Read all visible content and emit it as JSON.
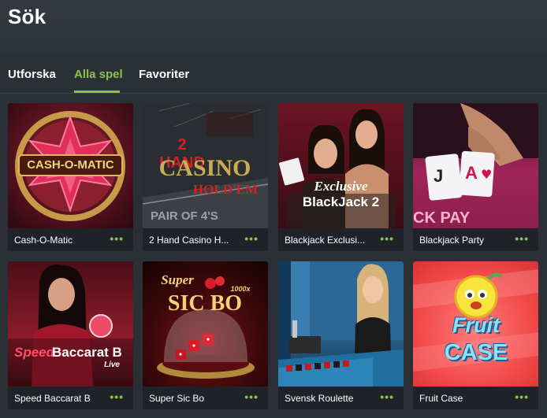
{
  "header": {
    "title": "Sök"
  },
  "tabs": [
    {
      "label": "Utforska"
    },
    {
      "label": "Alla spel"
    },
    {
      "label": "Favoriter"
    }
  ],
  "games": [
    {
      "label": "Cash-O-Matic",
      "art": "CASH-O-MATIC"
    },
    {
      "label": "2 Hand Casino H...",
      "art_top": "2 HAND",
      "art_mid": "CASINO",
      "art_bot": "HOLD'EM"
    },
    {
      "label": "Blackjack Exclusi...",
      "art_top": "Exclusive",
      "art_bot": "BlackJack 2"
    },
    {
      "label": "Blackjack Party",
      "art": "J A"
    },
    {
      "label": "Speed Baccarat B",
      "art_top": "Speed",
      "art_mid": "Baccarat B",
      "art_bot": "Live"
    },
    {
      "label": "Super Sic Bo",
      "art_top": "Super",
      "art_bot": "SIC BO",
      "art_extra": "1000x"
    },
    {
      "label": "Svensk Roulette"
    },
    {
      "label": "Fruit Case",
      "art_top": "Fruit",
      "art_bot": "CASE"
    }
  ],
  "colors": {
    "accent": "#8bc34a",
    "background": "#2b2f36",
    "card": "#1f2329"
  },
  "icons": {
    "more": "more-dots-icon"
  },
  "more_glyph": "•••"
}
